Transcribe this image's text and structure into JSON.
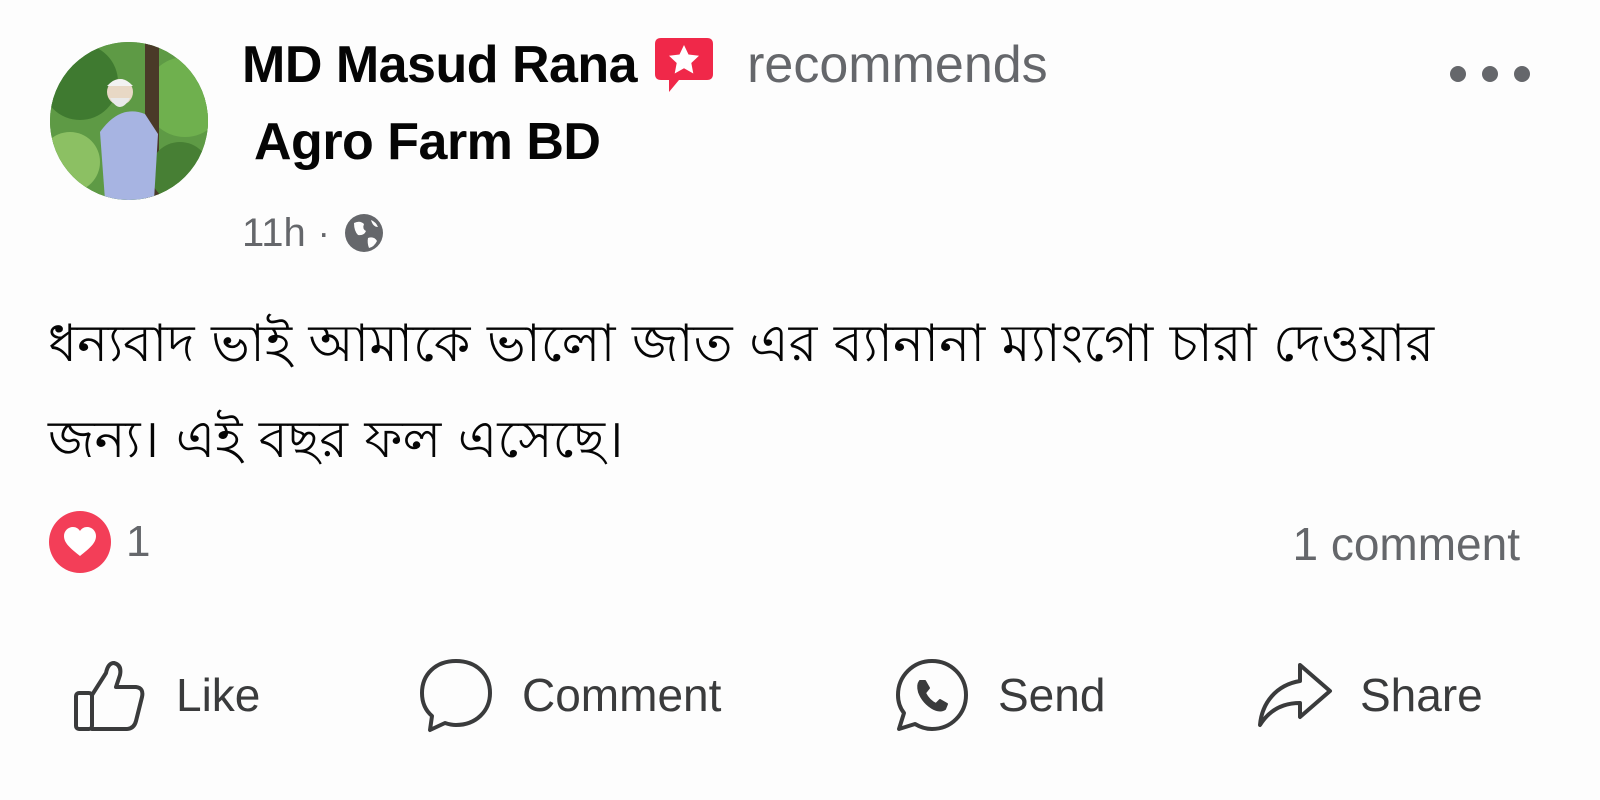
{
  "author": {
    "name": "MD Masud Rana",
    "action": "recommends",
    "avatar_icon": "profile-photo",
    "recommend_icon": "recommend-badge-icon"
  },
  "page": {
    "name": "Agro Farm BD"
  },
  "meta": {
    "time": "11h",
    "separator": "·",
    "privacy_icon": "globe-icon"
  },
  "post": {
    "text": "ধন্যবাদ ভাই আমাকে ভালো জাত এর ব্যানানা ম্যাংগো চারা দেওয়ার জন্য। এই বছর ফল এসেছে।"
  },
  "stats": {
    "reaction_icon": "heart-icon",
    "reaction_count": "1",
    "comment_count": "1 comment"
  },
  "actions": {
    "like": "Like",
    "comment": "Comment",
    "send": "Send",
    "share": "Share"
  },
  "colors": {
    "text_primary": "#050505",
    "text_secondary": "#65676b",
    "recommend_red": "#f02849",
    "heart_red": "#f33e58"
  }
}
